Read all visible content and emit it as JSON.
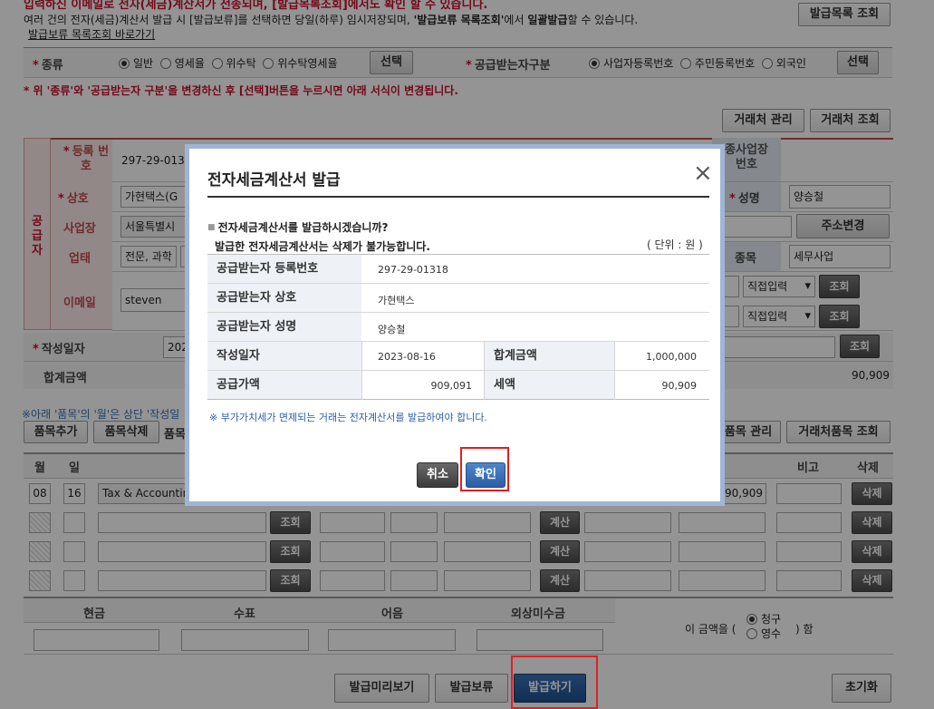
{
  "notice": {
    "line0": "입력하신 이메일로 전자(세금)계산서가 전송되며, [발급목록조회]에서도 확인 할 수 있습니다.",
    "line1_a": "여러 건의 전자(세금)계산서 발급 시 [발급보류]를 선택하면 당일(하루) 임시저장되며, ",
    "line1_b": "'발급보류 목록조회'",
    "line1_c": "에서 ",
    "line1_d": "일괄발급",
    "line1_e": "할 수 있습니다.",
    "link": "발급보류 목록조회 바로가기",
    "list_button": "발급목록 조회"
  },
  "type_row": {
    "label": "종류",
    "options": [
      "일반",
      "영세율",
      "위수탁",
      "위수탁영세율"
    ],
    "select_button": "선택",
    "receiver_label": "공급받는자구분",
    "receiver_options": [
      "사업자등록번호",
      "주민등록번호",
      "외국인"
    ],
    "receiver_select_button": "선택"
  },
  "warning": "* 위 '종류'와 '공급받는자 구분'을 변경하신 후 [선택]버튼을 누르시면 아래 서식이 변경됩니다.",
  "client_buttons": {
    "manage": "거래처 관리",
    "search": "거래처 조회"
  },
  "supplier": {
    "section_label": "공급자",
    "reg_label": "등록 번호",
    "reg_value": "297-29-01318",
    "name_label": "상호",
    "name_value": "가현택스(G",
    "addr_label": "사업장",
    "addr_value": "서울특별시",
    "biz_label": "업태",
    "biz_value": "전문, 과학",
    "email_label": "이메일",
    "email_value": "steven"
  },
  "right_side": {
    "branch_label": "종사업장 번호",
    "ceo_label": "성명",
    "ceo_value": "양승철",
    "addr_button": "주소변경",
    "item_label": "종목",
    "item_value": "세무사업",
    "direct_input": "직접입력",
    "search_button": "조회"
  },
  "date_row": {
    "label": "작성일자",
    "value": "202",
    "search_button": "조회"
  },
  "total_row": {
    "label": "합계금액",
    "tax_value": "90,909"
  },
  "items": {
    "note": "※아래 '품목'의 '월'은 상단 '작성일",
    "add_button": "품목추가",
    "delete_button": "품목삭제",
    "item_text": "품목",
    "manage_button": "품목 관리",
    "client_items_button": "거래처품목 조회",
    "headers": {
      "month": "월",
      "day": "일",
      "note": "비고",
      "delete": "삭제"
    },
    "row1": {
      "month": "08",
      "day": "16",
      "item": "Tax & Accountin",
      "amount": "90,909"
    },
    "search_button": "조회",
    "calc_button": "계산",
    "delete_button_row": "삭제"
  },
  "payment": {
    "headers": [
      "현금",
      "수표",
      "어음",
      "외상미수금"
    ],
    "claim_prefix": "이 금액을 (",
    "claim_options": [
      "청구",
      "영수"
    ],
    "claim_suffix": ") 함"
  },
  "bottom_buttons": {
    "preview": "발급미리보기",
    "hold": "발급보류",
    "issue": "발급하기",
    "reset": "초기화"
  },
  "modal": {
    "title": "전자세금계산서 발급",
    "close": "×",
    "question": "전자세금계산서를 발급하시겠습니까?",
    "warning": "발급한 전자세금계산서는 삭제가 불가능합니다.",
    "unit": "( 단위 : 원 )",
    "rows": [
      {
        "label": "공급받는자 등록번호",
        "value": "297-29-01318"
      },
      {
        "label": "공급받는자 상호",
        "value": "가현택스"
      },
      {
        "label": "공급받는자 성명",
        "value": "양승철"
      }
    ],
    "date_label": "작성일자",
    "date_value": "2023-08-16",
    "total_label": "합계금액",
    "total_value": "1,000,000",
    "supply_label": "공급가액",
    "supply_value": "909,091",
    "tax_label": "세액",
    "tax_value": "90,909",
    "footnote": "※ 부가가치세가 면제되는 거래는 전자계산서를 발급하여야 합니다.",
    "cancel": "취소",
    "confirm": "확인"
  }
}
